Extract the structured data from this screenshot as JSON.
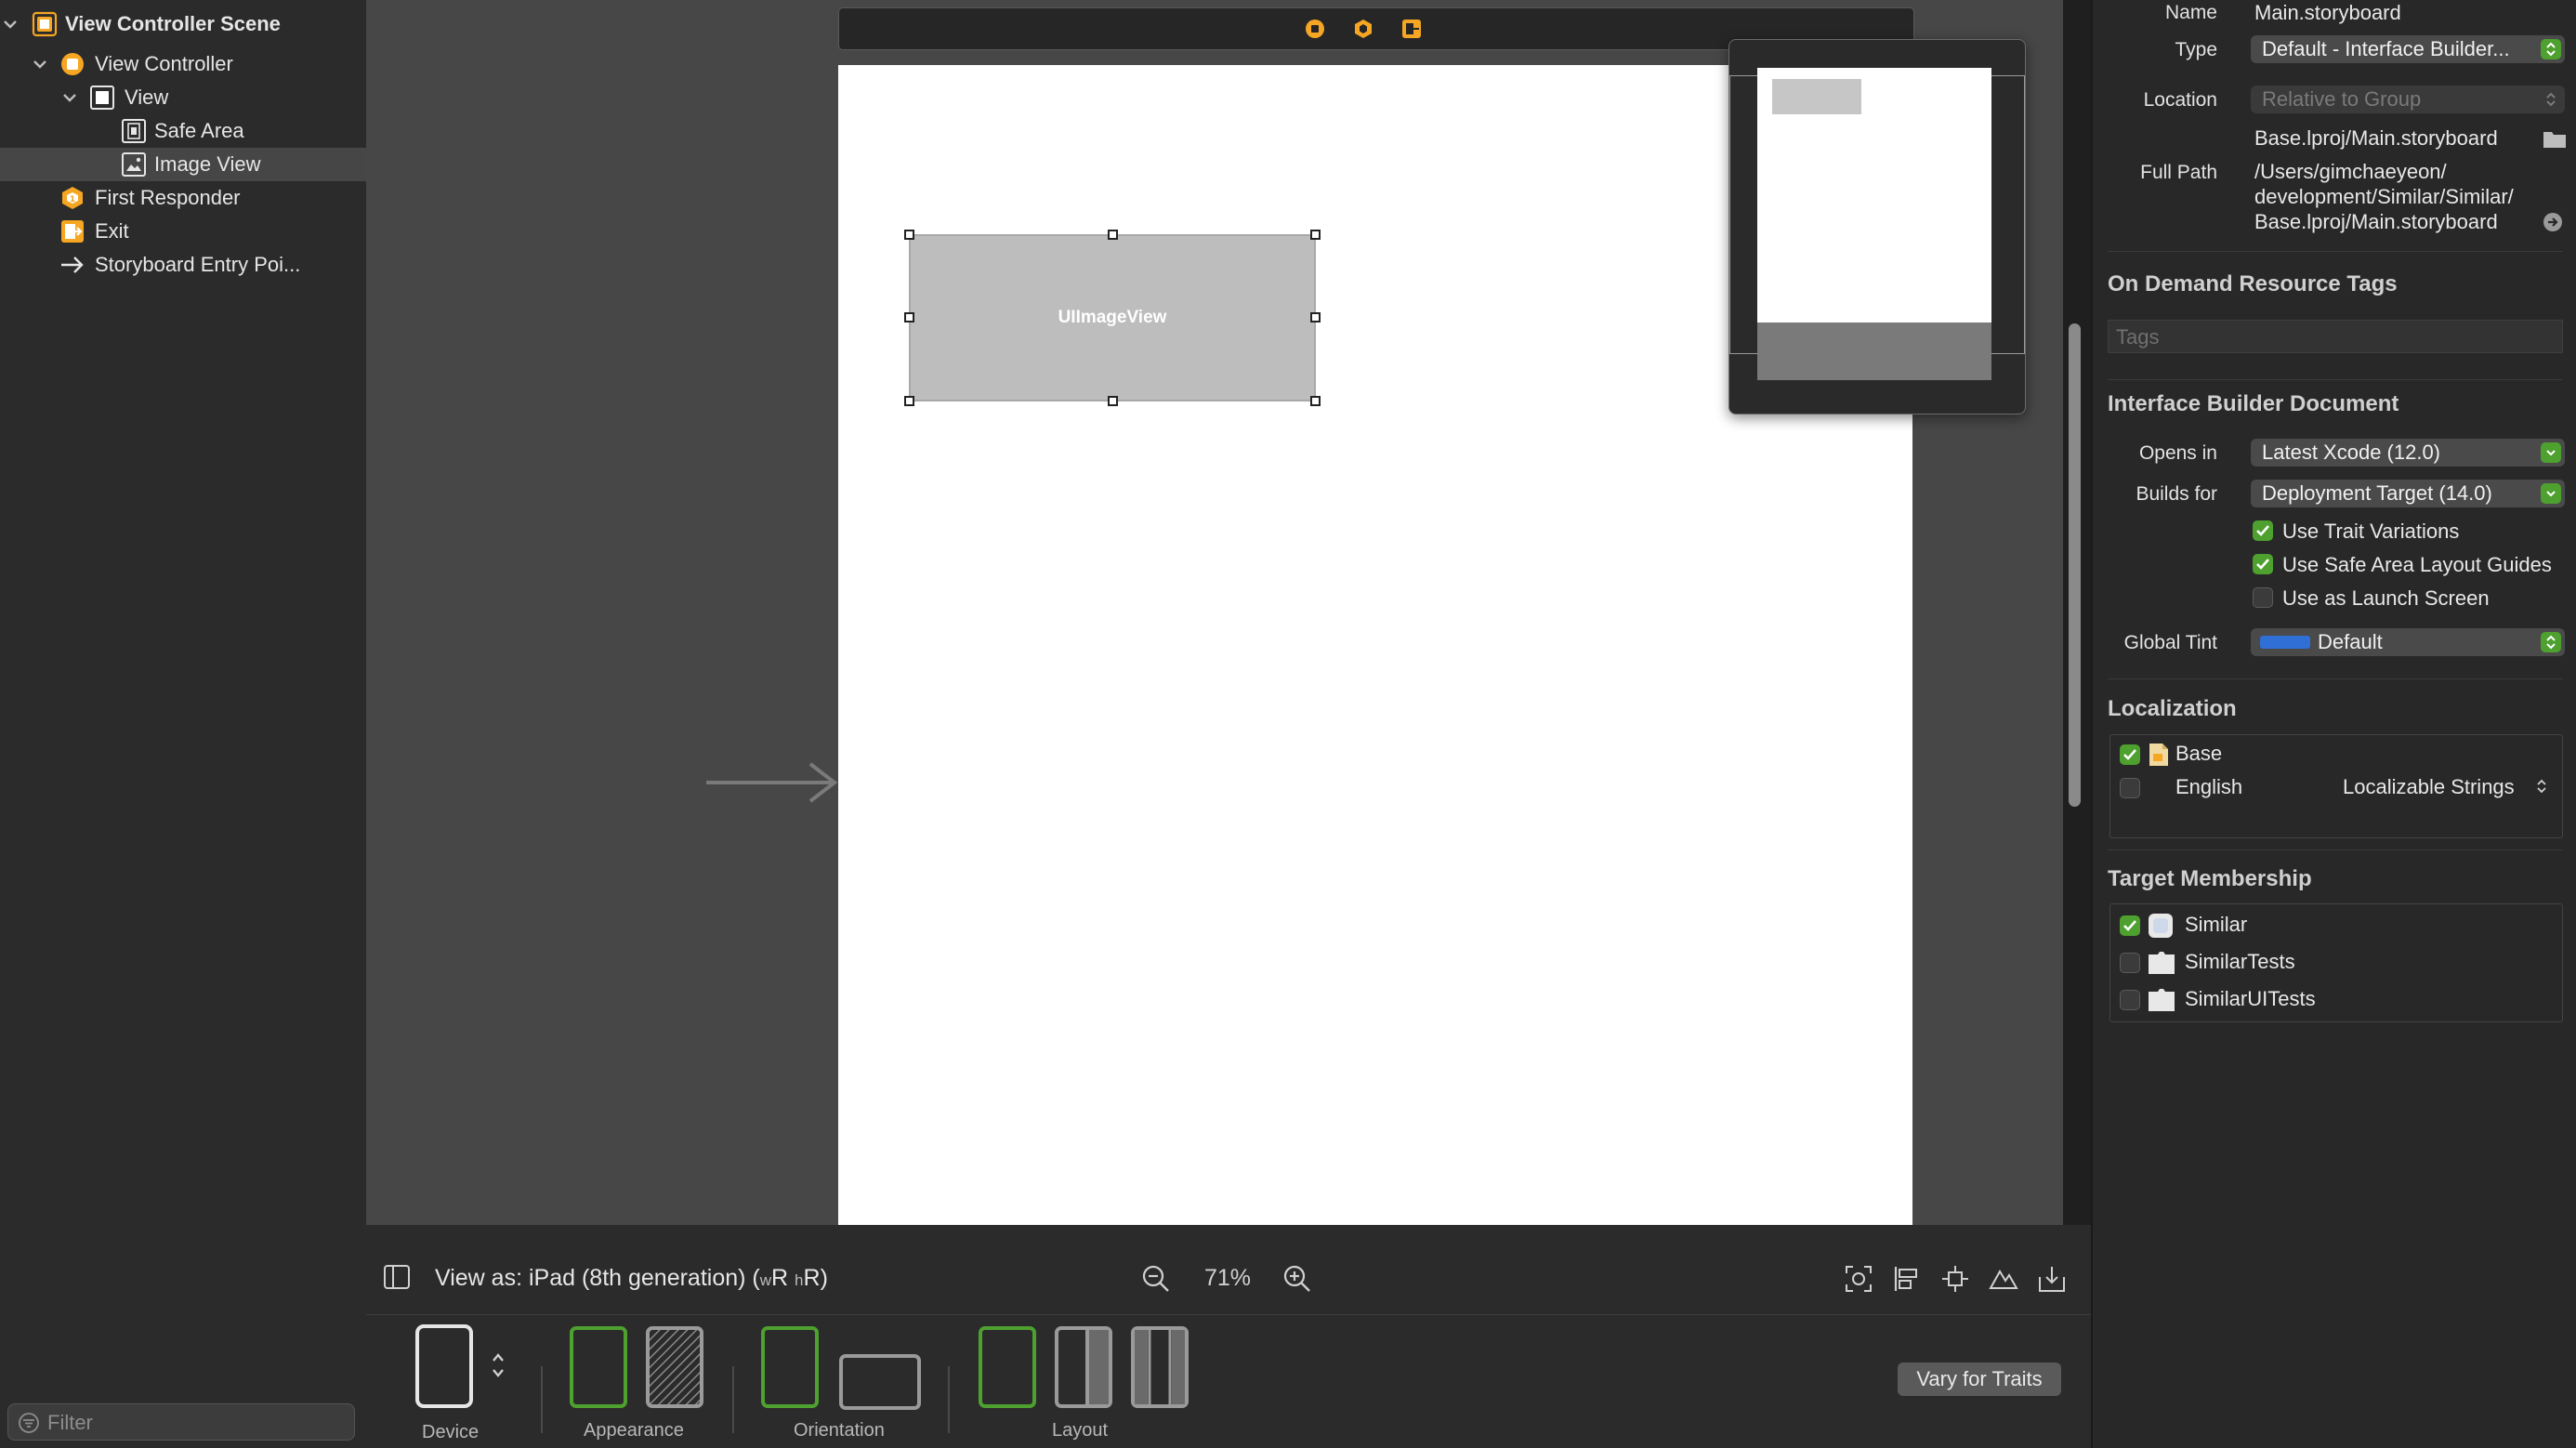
{
  "outline": {
    "items": [
      {
        "label": "View Controller Scene",
        "icon": "scene-icon"
      },
      {
        "label": "View Controller",
        "icon": "view-controller-icon"
      },
      {
        "label": "View",
        "icon": "view-icon"
      },
      {
        "label": "Safe Area",
        "icon": "safe-area-icon"
      },
      {
        "label": "Image View",
        "icon": "image-view-icon",
        "selected": true
      },
      {
        "label": "First Responder",
        "icon": "first-responder-icon"
      },
      {
        "label": "Exit",
        "icon": "exit-icon"
      },
      {
        "label": "Storyboard Entry Poi...",
        "icon": "entry-point-arrow-icon"
      }
    ],
    "filter_placeholder": "Filter"
  },
  "canvas": {
    "image_view_label": "UIImageView"
  },
  "bottom_bar": {
    "view_as_prefix": "View as: iPad (8th generation) (",
    "w_class": "w",
    "w_value": "R",
    "h_class": "h",
    "h_value": "R",
    "view_as_suffix": ")",
    "zoom": "71%",
    "groups": {
      "device": "Device",
      "appearance": "Appearance",
      "orientation": "Orientation",
      "layout": "Layout"
    },
    "vary_button": "Vary for Traits"
  },
  "inspector": {
    "identity": {
      "name_label": "Name",
      "name_value": "Main.storyboard",
      "type_label": "Type",
      "type_value": "Default - Interface Builder...",
      "location_label": "Location",
      "location_value": "Relative to Group",
      "location_file": "Base.lproj/Main.storyboard",
      "full_path_label": "Full Path",
      "full_path_lines": [
        "/Users/gimchaeyeon/",
        "development/Similar/Similar/",
        "Base.lproj/Main.storyboard"
      ]
    },
    "on_demand": {
      "title": "On Demand Resource Tags",
      "tags_placeholder": "Tags"
    },
    "ib_document": {
      "title": "Interface Builder Document",
      "opens_in_label": "Opens in",
      "opens_in_value": "Latest Xcode (12.0)",
      "builds_for_label": "Builds for",
      "builds_for_value": "Deployment Target (14.0)",
      "checkboxes": [
        {
          "label": "Use Trait Variations",
          "checked": true
        },
        {
          "label": "Use Safe Area Layout Guides",
          "checked": true
        },
        {
          "label": "Use as Launch Screen",
          "checked": false
        }
      ],
      "global_tint_label": "Global Tint",
      "global_tint_value": "Default",
      "global_tint_color": "#2f6fd6"
    },
    "localization": {
      "title": "Localization",
      "rows": [
        {
          "label": "Base",
          "checked": true,
          "type": ""
        },
        {
          "label": "English",
          "checked": false,
          "type": "Localizable Strings"
        }
      ]
    },
    "target_membership": {
      "title": "Target Membership",
      "rows": [
        {
          "label": "Similar",
          "checked": true
        },
        {
          "label": "SimilarTests",
          "checked": false
        },
        {
          "label": "SimilarUITests",
          "checked": false
        }
      ]
    }
  },
  "colors": {
    "accent_green": "#4ea02f",
    "scene_icon": "#f5a623",
    "device_border": "#e6e6e6"
  }
}
